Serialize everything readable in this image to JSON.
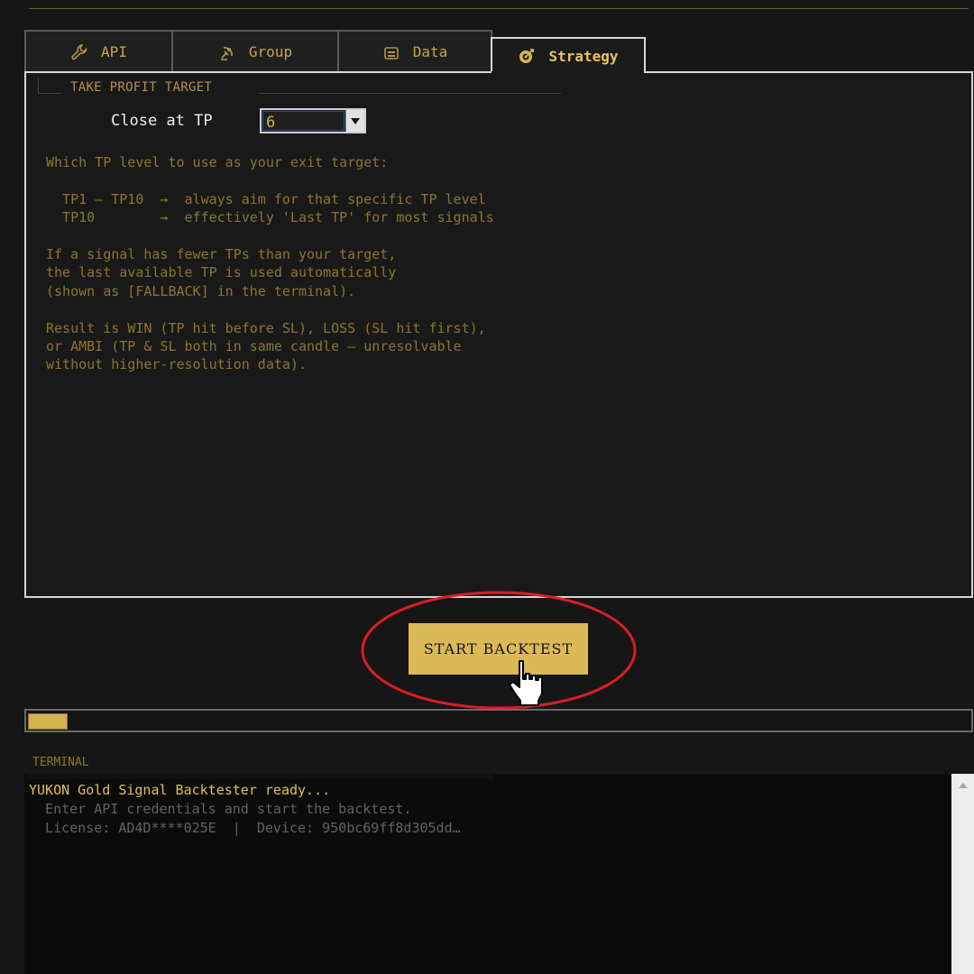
{
  "tabs": [
    {
      "label": "API",
      "icon": "wrench-icon",
      "active": false
    },
    {
      "label": "Group",
      "icon": "satellite-icon",
      "active": false
    },
    {
      "label": "Data",
      "icon": "database-icon",
      "active": false
    },
    {
      "label": "Strategy",
      "icon": "target-icon",
      "active": true
    }
  ],
  "strategy": {
    "group_title": "TAKE PROFIT TARGET",
    "close_label": "Close at TP",
    "close_value": "6",
    "description": [
      "Which TP level to use as your exit target:",
      "",
      "  TP1 – TP10  →  always aim for that specific TP level",
      "  TP10        →  effectively 'Last TP' for most signals",
      "",
      "If a signal has fewer TPs than your target,",
      "the last available TP is used automatically",
      "(shown as [FALLBACK] in the terminal).",
      "",
      "Result is WIN (TP hit before SL), LOSS (SL hit first),",
      "or AMBI (TP & SL both in same candle — unresolvable",
      "without higher-resolution data)."
    ]
  },
  "actions": {
    "start_label": "START BACKTEST"
  },
  "progress": {
    "fraction": 0.04
  },
  "terminal": {
    "label": "TERMINAL",
    "lines": [
      "YUKON Gold Signal Backtester ready...",
      "  Enter API credentials and start the backtest.",
      "  License: AD4D****025E  |  Device: 950bc69ff8d305dd…"
    ]
  },
  "colors": {
    "accent": "#dcb957",
    "annotation": "#d81e28",
    "text_dim": "#8c7630",
    "panel_border": "#d6d6d6"
  }
}
